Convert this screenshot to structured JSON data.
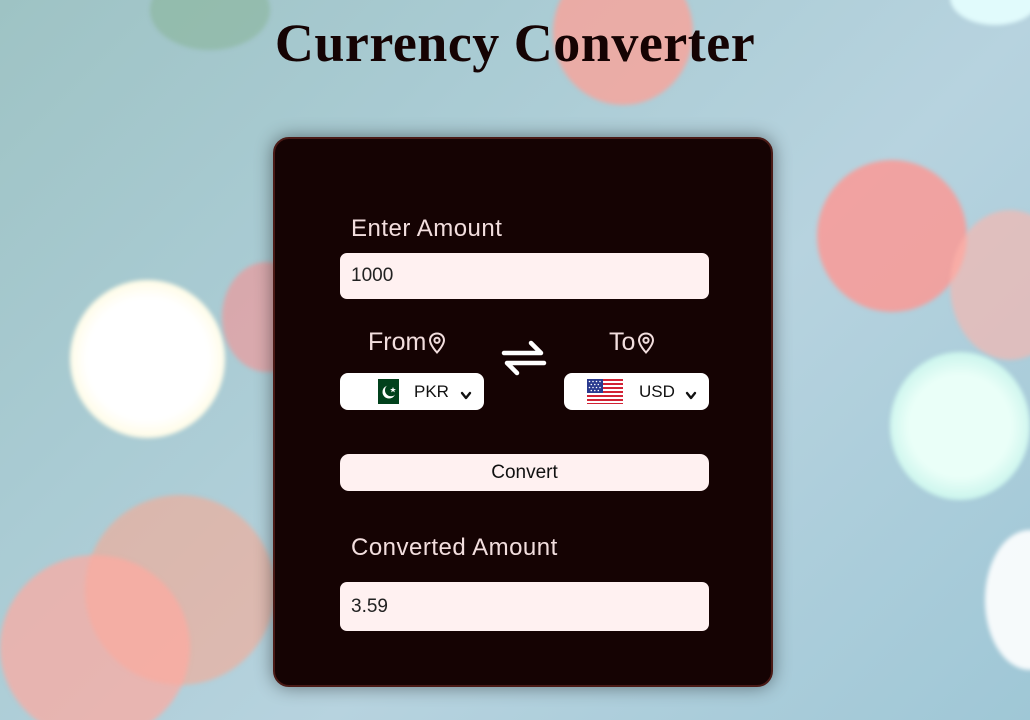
{
  "page": {
    "title": "Currency Converter"
  },
  "converter": {
    "amount_label": "Enter Amount",
    "amount_value": "1000",
    "from_label": "From",
    "to_label": "To",
    "from_currency": {
      "code": "PKR",
      "flag": "pakistan-flag-icon"
    },
    "to_currency": {
      "code": "USD",
      "flag": "usa-flag-icon"
    },
    "convert_label": "Convert",
    "result_label": "Converted Amount",
    "result_value": "3.59"
  },
  "colors": {
    "card_bg": "#150303",
    "field_bg": "#fff1f1",
    "label_text": "#f2dede",
    "title_text": "#150303"
  }
}
